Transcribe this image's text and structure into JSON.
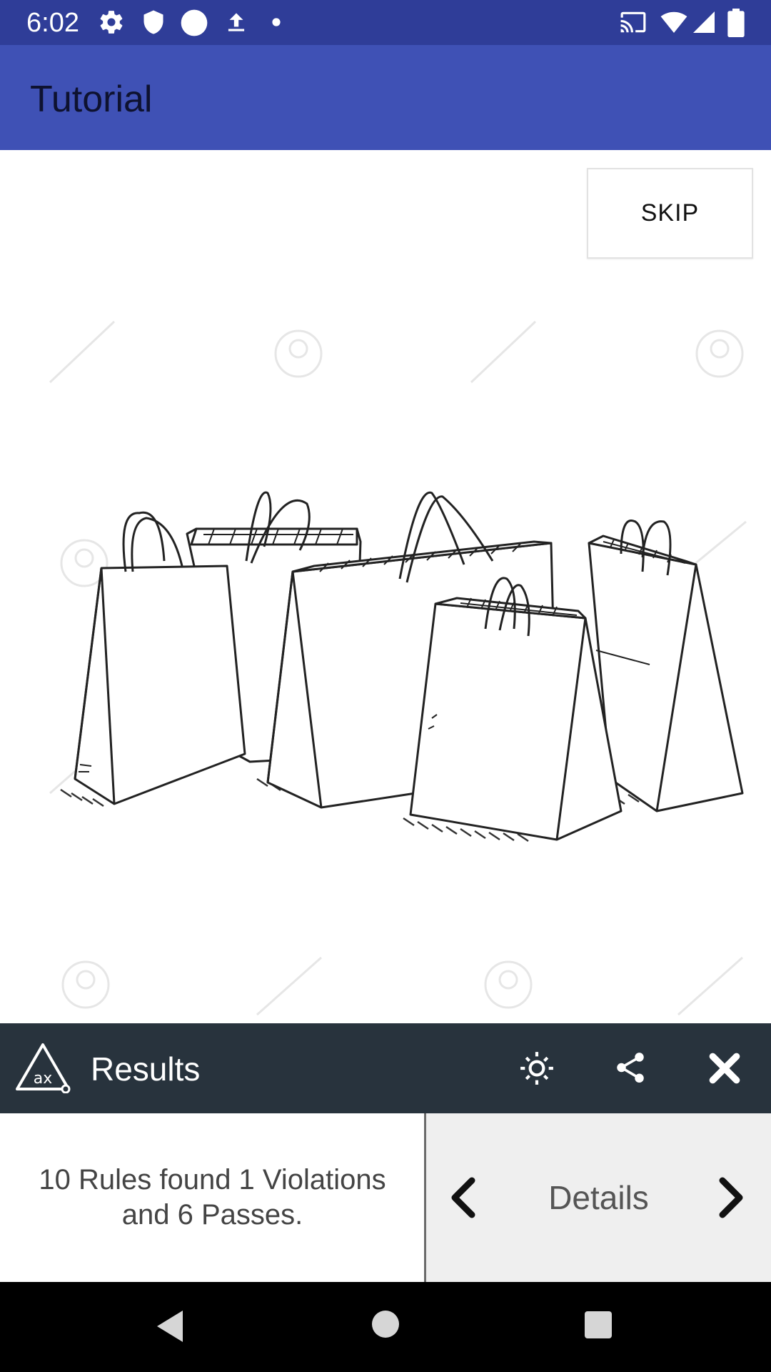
{
  "status_bar": {
    "time": "6:02",
    "left_icons": [
      "gear-icon",
      "shield-icon",
      "circle-icon",
      "upload-icon",
      "dot-icon"
    ],
    "right_icons": [
      "cast-icon",
      "wifi-icon",
      "signal-icon",
      "battery-icon"
    ]
  },
  "app_bar": {
    "title": "Tutorial"
  },
  "tutorial": {
    "skip_label": "SKIP",
    "illustration": "shopping-bags-sketch"
  },
  "results": {
    "logo": "ax-logo-icon",
    "title": "Results",
    "actions": [
      "settings-icon",
      "share-icon",
      "close-icon"
    ],
    "summary": "10 Rules found 1 Violations and 6 Passes.",
    "details_label": "Details"
  },
  "nav_bar": {
    "buttons": [
      "back",
      "home",
      "recents"
    ]
  },
  "colors": {
    "status_bar": "#2f3d98",
    "app_bar": "#3f51b5",
    "results_bar": "#28333d",
    "details_bg": "#efefef"
  }
}
